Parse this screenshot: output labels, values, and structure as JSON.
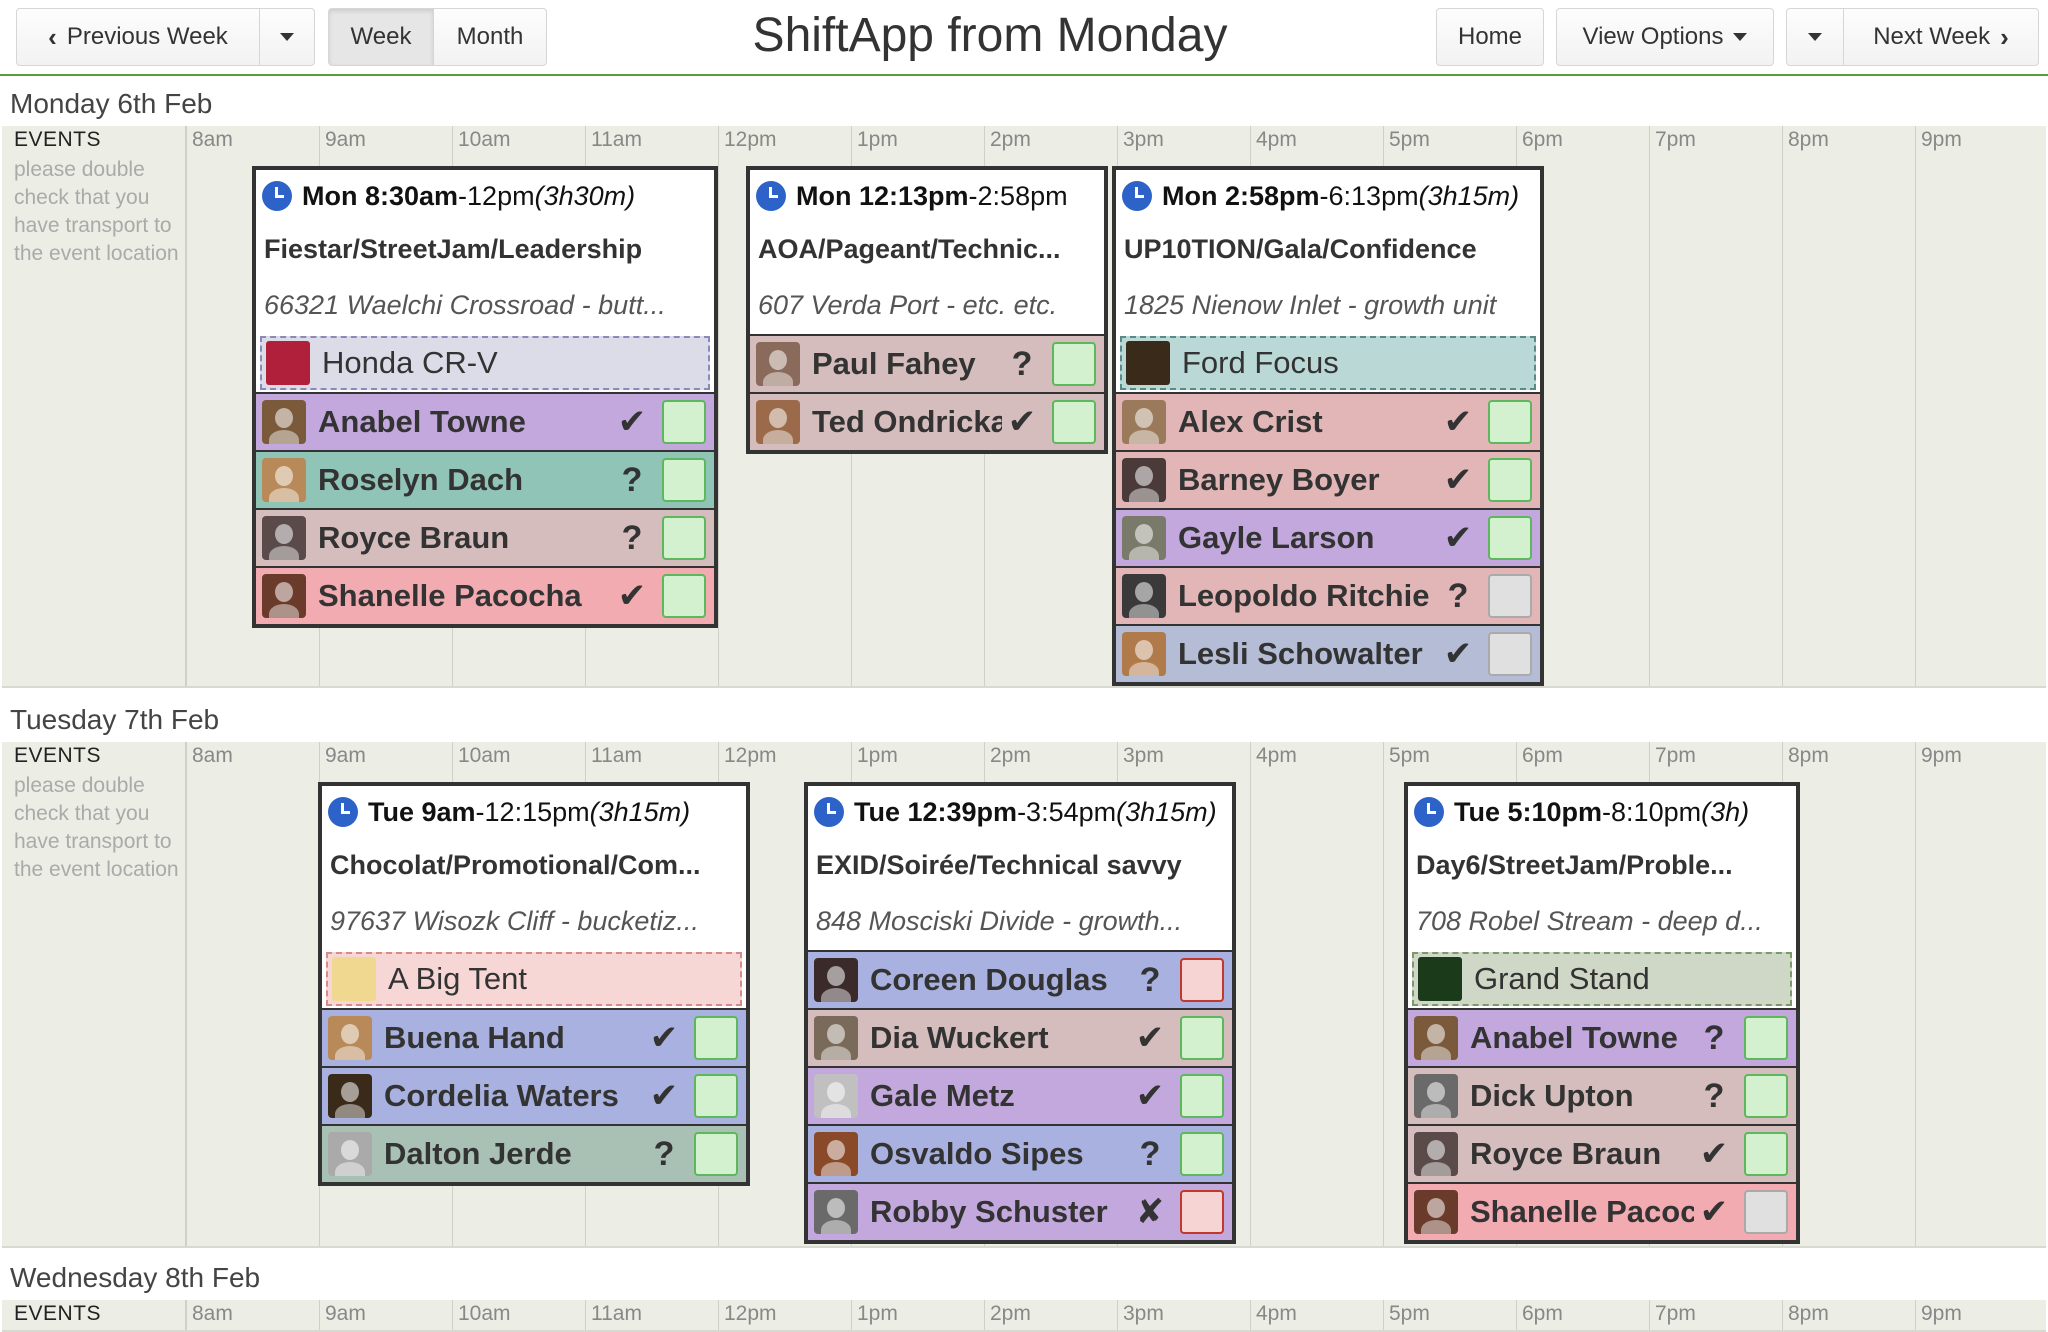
{
  "toolbar": {
    "prev_week": "Previous Week",
    "week": "Week",
    "month": "Month",
    "title": "ShiftApp from Monday",
    "home": "Home",
    "view_options": "View Options",
    "next_week": "Next Week"
  },
  "hours": [
    "8am",
    "9am",
    "10am",
    "11am",
    "12pm",
    "1pm",
    "2pm",
    "3pm",
    "4pm",
    "5pm",
    "6pm",
    "7pm",
    "8pm",
    "9pm"
  ],
  "events_col": {
    "title": "EVENTS",
    "note": "please double check that you have transport to the event location"
  },
  "days": [
    {
      "label": "Monday 6th Feb",
      "events": [
        {
          "start": "Mon 8:30am",
          "end": "-12pm",
          "duration": "(3h30m)",
          "name": "Fiestar/StreetJam/Leadership",
          "location": "66321 Waelchi Crossroad - butt...",
          "vehicle": {
            "name": "Honda CR-V",
            "bg": "#dcdce9",
            "border": "#8a8ab8",
            "icon_color": "#b0203a"
          },
          "staff": [
            {
              "name": "Anabel Towne",
              "status": "✔",
              "check": "green",
              "bg": "#c3a8de",
              "avatar": "#7a5a3a"
            },
            {
              "name": "Roselyn Dach",
              "status": "?",
              "check": "green",
              "bg": "#8fc4b6",
              "avatar": "#b88a5a"
            },
            {
              "name": "Royce Braun",
              "status": "?",
              "check": "green",
              "bg": "#d6bdbd",
              "avatar": "#5a4a4a"
            },
            {
              "name": "Shanelle Pacocha",
              "status": "✔",
              "check": "green",
              "bg": "#f2abb0",
              "avatar": "#6a3a2a"
            }
          ]
        },
        {
          "start": "Mon 12:13pm",
          "end": "-2:58pm",
          "duration": "",
          "name": "AOA/Pageant/Technic...",
          "location": "607 Verda Port - etc. etc.",
          "vehicle": null,
          "staff": [
            {
              "name": "Paul Fahey",
              "status": "?",
              "check": "green",
              "bg": "#d6bdbd",
              "avatar": "#8a6a5a"
            },
            {
              "name": "Ted Ondricka",
              "status": "✔",
              "check": "green",
              "bg": "#d6bdbd",
              "avatar": "#9a6a4a"
            }
          ]
        },
        {
          "start": "Mon 2:58pm",
          "end": "-6:13pm",
          "duration": "(3h15m)",
          "name": "UP10TION/Gala/Confidence",
          "location": "1825 Nienow Inlet - growth unit",
          "vehicle": {
            "name": "Ford Focus",
            "bg": "#b9d8d6",
            "border": "#5a8a88",
            "icon_color": "#3a2a1a"
          },
          "staff": [
            {
              "name": "Alex Crist",
              "status": "✔",
              "check": "green",
              "bg": "#e2b6b6",
              "avatar": "#9a7a5a"
            },
            {
              "name": "Barney Boyer",
              "status": "✔",
              "check": "green",
              "bg": "#e2b6b6",
              "avatar": "#4a3a3a"
            },
            {
              "name": "Gayle Larson",
              "status": "✔",
              "check": "green",
              "bg": "#c3a8de",
              "avatar": "#7a7a6a"
            },
            {
              "name": "Leopoldo Ritchie",
              "status": "?",
              "check": "grey",
              "bg": "#e2b6b6",
              "avatar": "#3a3a3a"
            },
            {
              "name": "Lesli Schowalter",
              "status": "✔",
              "check": "grey",
              "bg": "#b4bcd6",
              "avatar": "#b07a4a"
            }
          ]
        }
      ]
    },
    {
      "label": "Tuesday 7th Feb",
      "events": [
        {
          "start": "Tue 9am",
          "end": "-12:15pm",
          "duration": "(3h15m)",
          "name": "Chocolat/Promotional/Com...",
          "location": "97637 Wisozk Cliff - bucketiz...",
          "vehicle": {
            "name": "A Big Tent",
            "bg": "#f7d6d6",
            "border": "#d88a8a",
            "icon_color": "#f0d890"
          },
          "staff": [
            {
              "name": "Buena Hand",
              "status": "✔",
              "check": "green",
              "bg": "#a9b1e0",
              "avatar": "#b88a5a"
            },
            {
              "name": "Cordelia Waters",
              "status": "✔",
              "check": "green",
              "bg": "#a9b1e0",
              "avatar": "#3a2a1a"
            },
            {
              "name": "Dalton Jerde",
              "status": "?",
              "check": "green",
              "bg": "#a9c0b4",
              "avatar": "#aaa"
            }
          ]
        },
        {
          "start": "Tue 12:39pm",
          "end": "-3:54pm",
          "duration": "(3h15m)",
          "name": "EXID/Soirée/Technical savvy",
          "location": "848 Mosciski Divide - growth...",
          "vehicle": null,
          "staff": [
            {
              "name": "Coreen Douglas",
              "status": "?",
              "check": "red",
              "bg": "#a9b1e0",
              "avatar": "#3a2a2a"
            },
            {
              "name": "Dia Wuckert",
              "status": "✔",
              "check": "green",
              "bg": "#d6bdbd",
              "avatar": "#7a6a5a"
            },
            {
              "name": "Gale Metz",
              "status": "✔",
              "check": "green",
              "bg": "#c3a8de",
              "avatar": "#c0c0c0"
            },
            {
              "name": "Osvaldo Sipes",
              "status": "?",
              "check": "green",
              "bg": "#a9b1e0",
              "avatar": "#8a4a2a"
            },
            {
              "name": "Robby Schuster",
              "status": "✘",
              "check": "red",
              "bg": "#c3a8de",
              "avatar": "#6a6a6a"
            }
          ]
        },
        {
          "start": "Tue 5:10pm",
          "end": "-8:10pm",
          "duration": "(3h)",
          "name": "Day6/StreetJam/Proble...",
          "location": "708 Robel Stream - deep d...",
          "vehicle": {
            "name": "Grand Stand",
            "bg": "#cfd8c6",
            "border": "#7a9a6a",
            "icon_color": "#1a3a1a"
          },
          "staff": [
            {
              "name": "Anabel Towne",
              "status": "?",
              "check": "green",
              "bg": "#c3a8de",
              "avatar": "#7a5a3a"
            },
            {
              "name": "Dick Upton",
              "status": "?",
              "check": "green",
              "bg": "#d6bdbd",
              "avatar": "#6a6a6a"
            },
            {
              "name": "Royce Braun",
              "status": "✔",
              "check": "green",
              "bg": "#d6bdbd",
              "avatar": "#5a4a4a"
            },
            {
              "name": "Shanelle Pacocha",
              "status": "✔",
              "check": "grey",
              "bg": "#f2abb0",
              "avatar": "#6a3a2a"
            }
          ]
        }
      ]
    },
    {
      "label": "Wednesday 8th Feb",
      "events": []
    }
  ]
}
